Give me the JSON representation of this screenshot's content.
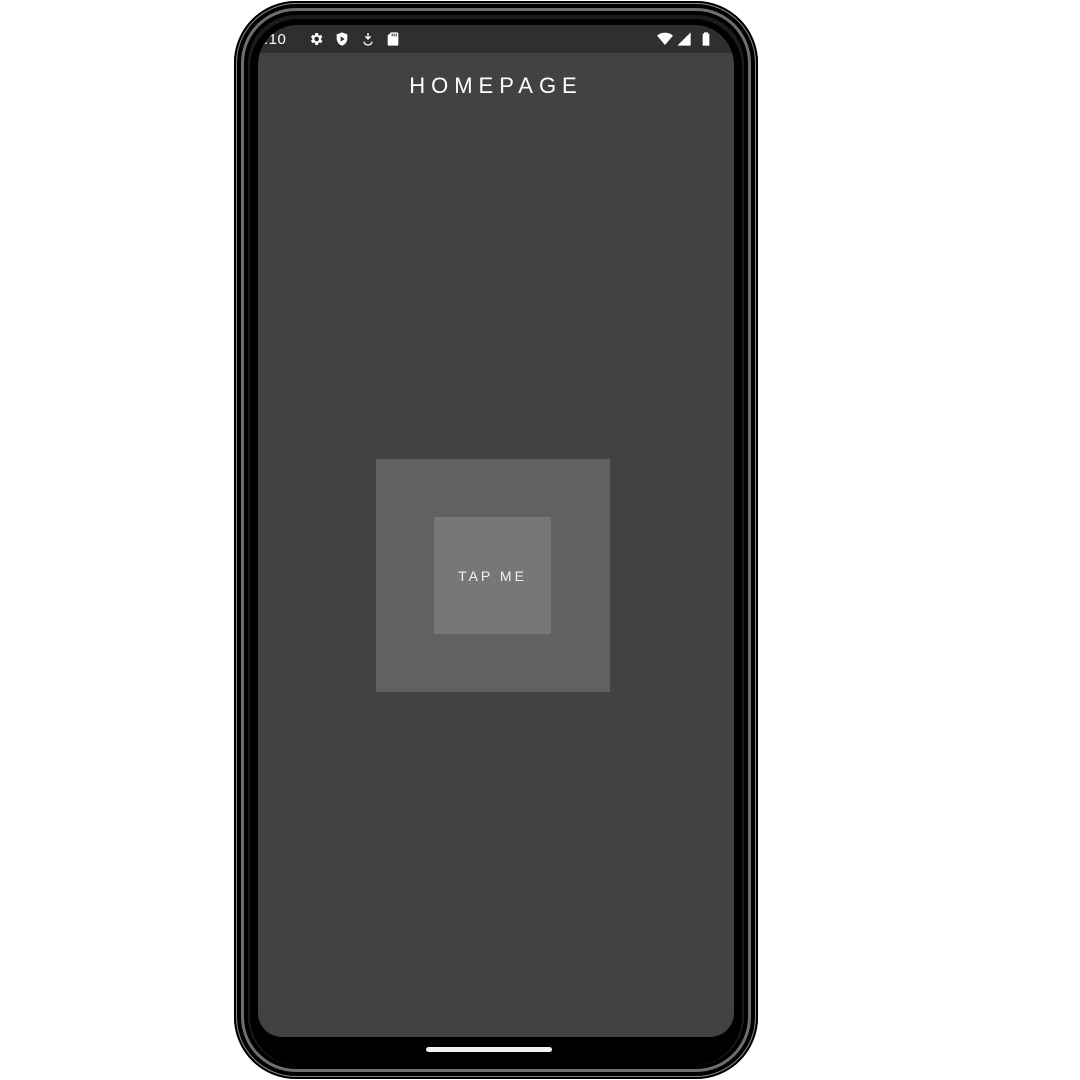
{
  "status_bar": {
    "time": ":10",
    "left_icons": [
      "settings-icon",
      "shield-play-icon",
      "download-icon",
      "sd-card-icon"
    ],
    "right_icons": [
      "wifi-icon",
      "signal-icon",
      "battery-icon"
    ]
  },
  "header": {
    "title": "HOMEPAGE"
  },
  "main": {
    "tap_button_label": "TAP ME"
  },
  "colors": {
    "screen_background": "#424242",
    "outer_square": "#616161",
    "tap_button": "#777777",
    "text": "#ffffff"
  }
}
